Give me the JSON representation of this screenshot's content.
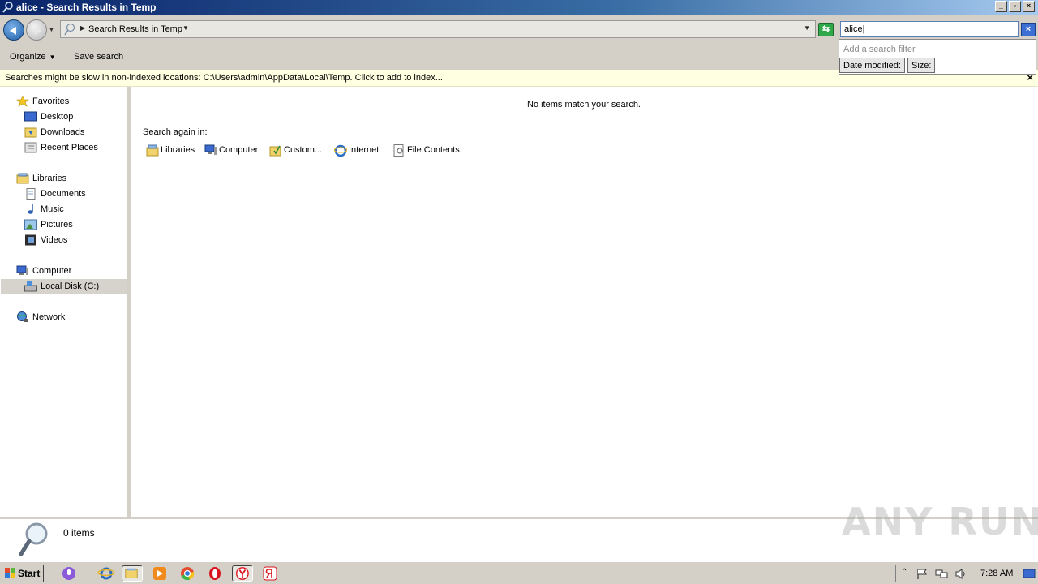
{
  "window": {
    "title": "alice - Search Results in Temp",
    "min_label": "_",
    "max_label": "▫",
    "close_label": "×"
  },
  "address": {
    "breadcrumb": "Search Results in Temp"
  },
  "search": {
    "value": "alice",
    "filter_hint": "Add a search filter",
    "filters": [
      "Date modified:",
      "Size:"
    ]
  },
  "toolbar": {
    "organize_label": "Organize",
    "save_search_label": "Save search"
  },
  "infobar": {
    "message": "Searches might be slow in non-indexed locations: C:\\Users\\admin\\AppData\\Local\\Temp. Click to add to index...",
    "close_label": "×"
  },
  "navpane": {
    "favorites": "Favorites",
    "desktop": "Desktop",
    "downloads": "Downloads",
    "recent_places": "Recent Places",
    "libraries": "Libraries",
    "documents": "Documents",
    "music": "Music",
    "pictures": "Pictures",
    "videos": "Videos",
    "computer": "Computer",
    "local_disk": "Local Disk (C:)",
    "network": "Network"
  },
  "content": {
    "no_items": "No items match your search.",
    "search_again_label": "Search again in:",
    "search_again": [
      "Libraries",
      "Computer",
      "Custom...",
      "Internet",
      "File Contents"
    ]
  },
  "details": {
    "count": "0 items"
  },
  "watermark": {
    "text": "ANY RUN"
  },
  "taskbar": {
    "start_label": "Start",
    "clock": "7:28 AM"
  },
  "colors": {
    "titlebar_start": "#0a246a",
    "infobar_bg": "#ffffe1",
    "selected_nav": "#d6d3cc"
  }
}
